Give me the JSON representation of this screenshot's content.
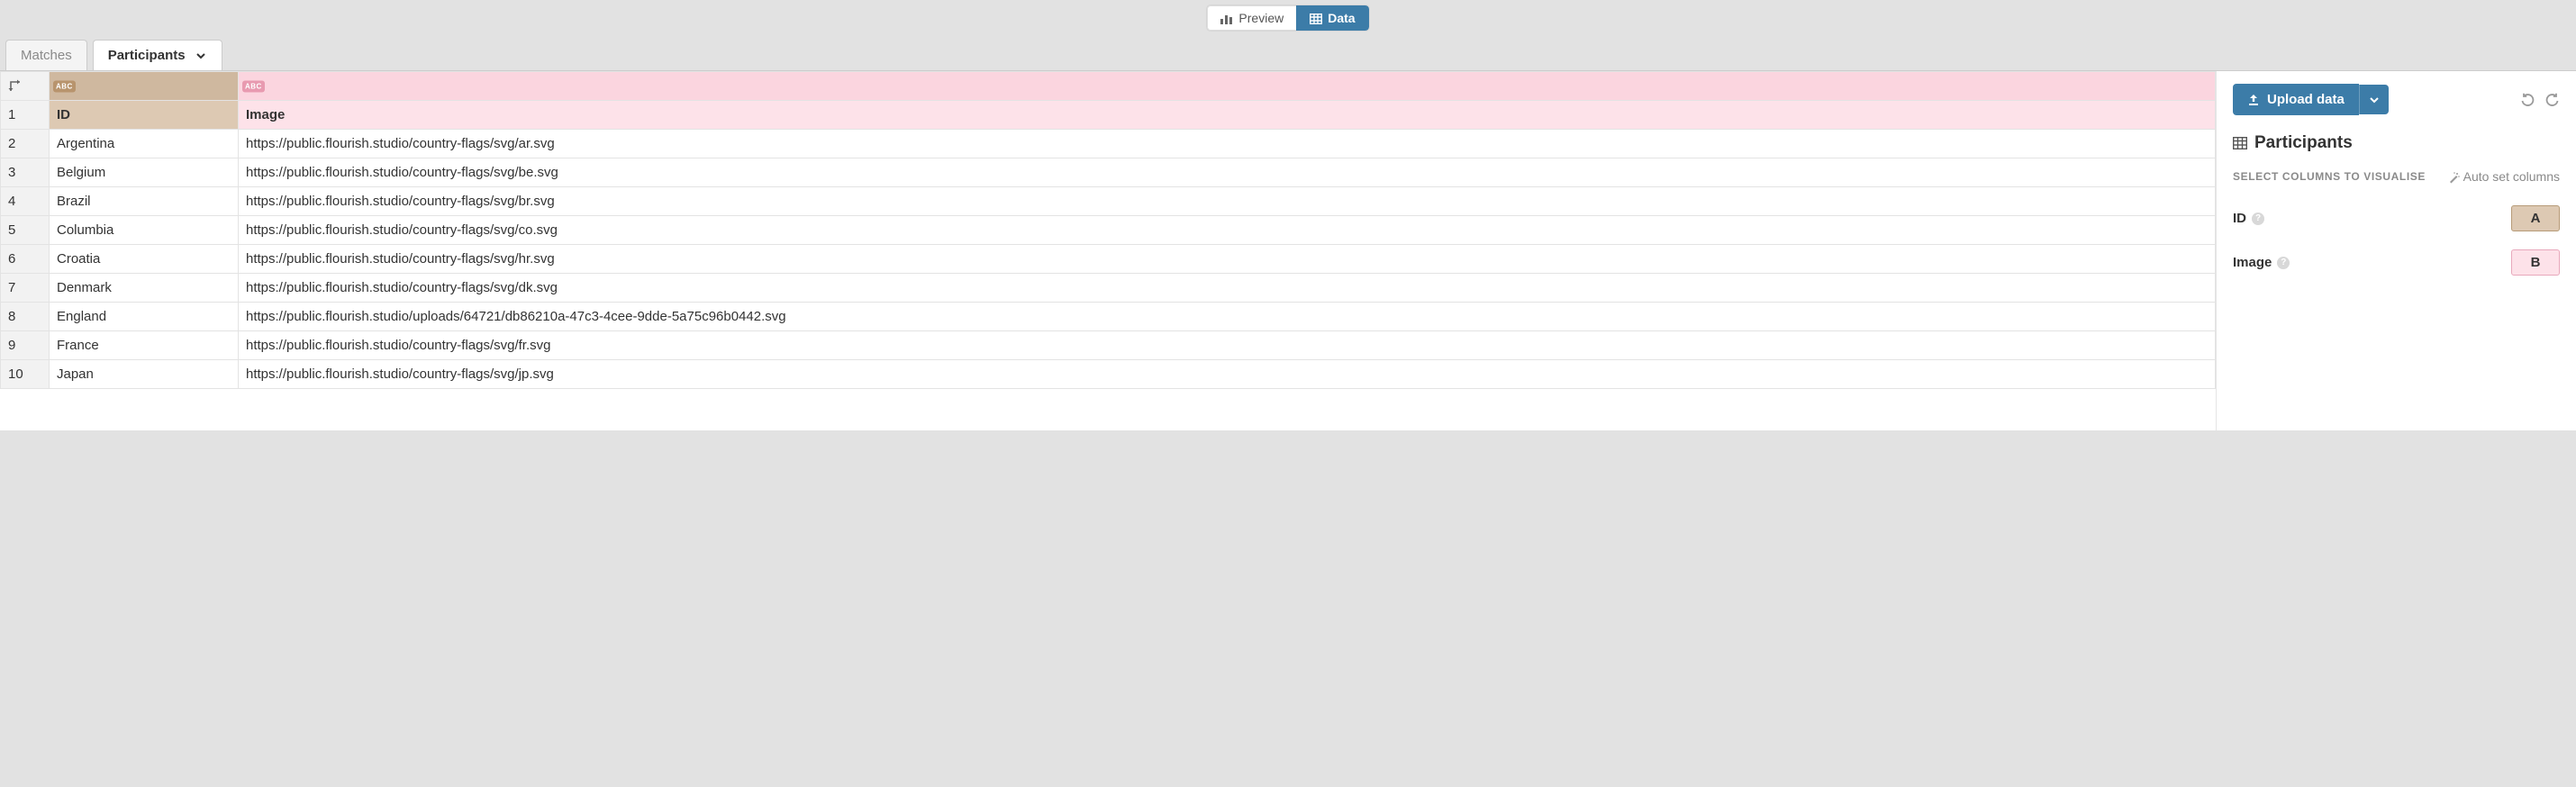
{
  "topbar": {
    "preview_label": "Preview",
    "data_label": "Data"
  },
  "sheet_tabs": {
    "matches": "Matches",
    "participants": "Participants"
  },
  "columns": {
    "A": {
      "letter": "A",
      "type_badge": "ABC"
    },
    "B": {
      "letter": "B",
      "type_badge": "ABC"
    }
  },
  "header_row": {
    "A": "ID",
    "B": "Image"
  },
  "rows": [
    {
      "n": "1",
      "A": "ID",
      "B": "Image"
    },
    {
      "n": "2",
      "A": "Argentina",
      "B": "https://public.flourish.studio/country-flags/svg/ar.svg"
    },
    {
      "n": "3",
      "A": "Belgium",
      "B": "https://public.flourish.studio/country-flags/svg/be.svg"
    },
    {
      "n": "4",
      "A": "Brazil",
      "B": "https://public.flourish.studio/country-flags/svg/br.svg"
    },
    {
      "n": "5",
      "A": "Columbia",
      "B": "https://public.flourish.studio/country-flags/svg/co.svg"
    },
    {
      "n": "6",
      "A": "Croatia",
      "B": "https://public.flourish.studio/country-flags/svg/hr.svg"
    },
    {
      "n": "7",
      "A": "Denmark",
      "B": "https://public.flourish.studio/country-flags/svg/dk.svg"
    },
    {
      "n": "8",
      "A": "England",
      "B": "https://public.flourish.studio/uploads/64721/db86210a-47c3-4cee-9dde-5a75c96b0442.svg"
    },
    {
      "n": "9",
      "A": "France",
      "B": "https://public.flourish.studio/country-flags/svg/fr.svg"
    },
    {
      "n": "10",
      "A": "Japan",
      "B": "https://public.flourish.studio/country-flags/svg/jp.svg"
    }
  ],
  "side": {
    "upload_label": "Upload data",
    "panel_title": "Participants",
    "select_columns_label": "SELECT COLUMNS TO VISUALISE",
    "auto_set_label": "Auto set columns",
    "bindings": {
      "id": {
        "label": "ID",
        "col": "A"
      },
      "image": {
        "label": "Image",
        "col": "B"
      }
    }
  }
}
